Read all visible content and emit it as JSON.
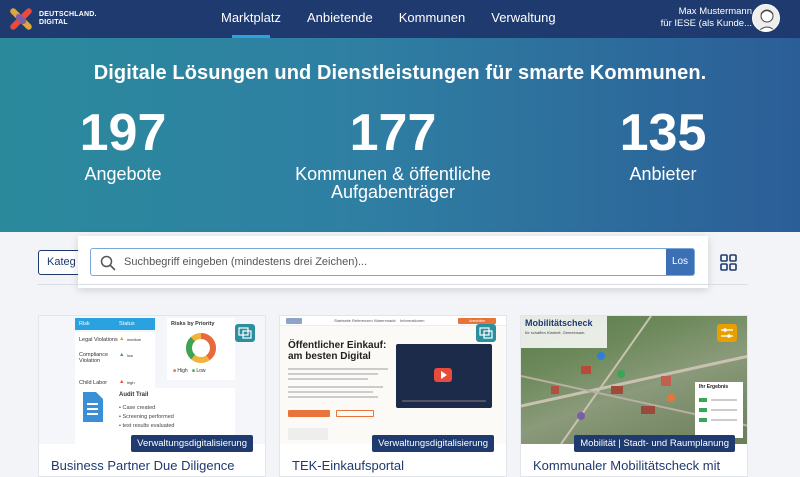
{
  "nav": {
    "logo_line1": "DEUTSCHLAND.",
    "logo_line2": "DIGITAL",
    "links": [
      {
        "label": "Marktplatz",
        "active": true
      },
      {
        "label": "Anbietende",
        "active": false
      },
      {
        "label": "Kommunen",
        "active": false
      },
      {
        "label": "Verwaltung",
        "active": false
      }
    ],
    "user_name": "Max Mustermann",
    "user_role": "für IESE (als Kunde..."
  },
  "hero": {
    "title": "Digitale Lösungen und Dienstleistungen für smarte Kommunen.",
    "stats": [
      {
        "value": "197",
        "label": "Angebote"
      },
      {
        "value": "177",
        "label": "Kommunen & öffentliche Aufgabenträger"
      },
      {
        "value": "135",
        "label": "Anbieter"
      }
    ]
  },
  "toolbar": {
    "filter_label": "Kateg",
    "search_placeholder": "Suchbegriff eingeben (mindestens drei Zeichen)...",
    "search_button": "Los"
  },
  "cards": [
    {
      "title": "Business Partner Due Diligence",
      "category": "Verwaltungsdigitalisierung",
      "thumb": {
        "table_headers": [
          "Risk",
          "Status"
        ],
        "table_rows": [
          "Legal Violations",
          "Compliance Violation",
          "Child Labor"
        ],
        "risk_levels": [
          "medium",
          "low",
          "high"
        ],
        "chart_title": "Risks by Priority",
        "legend": [
          "High",
          "Low"
        ],
        "audit_title": "Audit Trail",
        "audit_items": [
          "Case created",
          "Screening performed",
          "test results evaluated"
        ]
      }
    },
    {
      "title": "TEK-Einkaufsportal",
      "category": "Verwaltungsdigitalisierung",
      "thumb": {
        "headline_1": "Öffentlicher Einkauf:",
        "headline_2": "am besten Digital",
        "menu": [
          "Startseite",
          "Referenzen",
          "Warenmarkt",
          "Informationen"
        ],
        "cta": "Anmelden"
      }
    },
    {
      "title": "Kommunaler Mobilitätscheck mit",
      "category": "Mobilität | Stadt- und Raumplanung",
      "thumb": {
        "title": "Mobilitätscheck",
        "subtitle": "für schaffen Klarheit. Gemeinsam.",
        "result_title": "Ihr Ergebnis"
      }
    }
  ],
  "colors": {
    "nav": "#1f3a6e",
    "accent": "#29a3e0",
    "hero_left": "#2a8a9c",
    "hero_right": "#2b5e97",
    "badge": "#1f3a6e",
    "bookmark": "#2b8fa0"
  }
}
